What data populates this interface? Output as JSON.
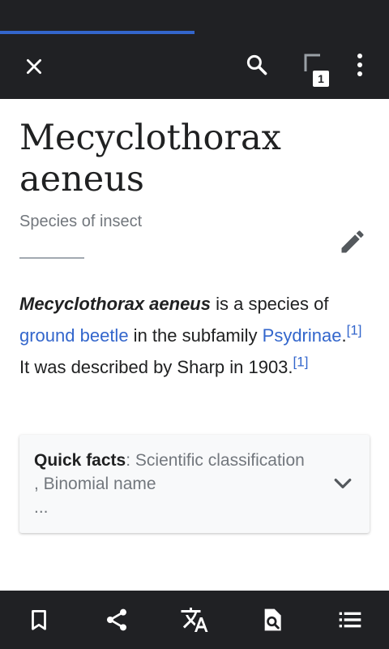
{
  "loading_progress_percent": 50,
  "toolbar": {
    "close_icon": "close-icon",
    "search_icon": "search-icon",
    "tabs_icon": "tabs-icon",
    "tabs_count": "1",
    "overflow_icon": "more-vertical-icon"
  },
  "article": {
    "title": "Mecyclothorax aeneus",
    "description": "Species of insect",
    "edit_icon": "pencil-icon",
    "lead": {
      "term": "Mecyclothorax aeneus",
      "text1": " is a species of ",
      "link1": "ground beetle",
      "text2": " in the subfamily ",
      "link2": "Psydrinae",
      "text3": ".",
      "ref1": "[1]",
      "text4": " It was described by Sharp in 1903.",
      "ref2": "[1]"
    },
    "quick_facts": {
      "label": "Quick facts",
      "separator": ": ",
      "summary": "Scientific classification , Binomial name",
      "ellipsis": "...",
      "expand_icon": "chevron-down-icon"
    }
  },
  "bottom_toolbar": [
    {
      "name": "save-button",
      "icon": "bookmark-icon"
    },
    {
      "name": "share-button",
      "icon": "share-icon"
    },
    {
      "name": "languages-button",
      "icon": "translate-icon"
    },
    {
      "name": "find-in-page-button",
      "icon": "find-in-page-icon"
    },
    {
      "name": "contents-button",
      "icon": "list-icon"
    }
  ],
  "colors": {
    "chrome": "#202124",
    "accent": "#3366cc",
    "text": "#202122",
    "muted": "#72777d",
    "card": "#f8f9fa"
  }
}
